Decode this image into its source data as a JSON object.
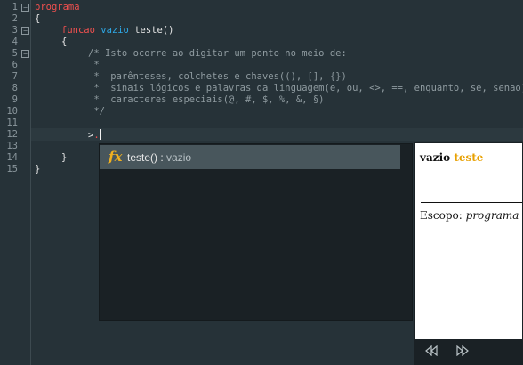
{
  "editor": {
    "line_numbers": [
      "1",
      "2",
      "3",
      "4",
      "5",
      "6",
      "7",
      "8",
      "9",
      "10",
      "11",
      "12",
      "13",
      "14",
      "15"
    ],
    "fold_markers": [
      "−",
      "−",
      "−"
    ],
    "code": {
      "l1": "programa",
      "l2": "{",
      "l3_kw": "funcao",
      "l3_type": "vazio",
      "l3_rest": "teste()",
      "l4": "{",
      "l5": "/* Isto ocorre ao digitar um ponto no meio de:",
      "l6": " *",
      "l7": " *  parênteses, colchetes e chaves((), [], {})",
      "l8": " *  sinais lógicos e palavras da linguagem(e, ou, <>, ==, enquanto, se, senao)",
      "l9": " *  caracteres especiais(@, #, $, %, &, §)",
      "l10": " */",
      "l12_a": ">",
      "l12_b": ".",
      "l14": "}",
      "l15": "}"
    }
  },
  "autocomplete": {
    "icon": "fx-icon",
    "name": "teste()",
    "separator": " : ",
    "return_type": "vazio"
  },
  "doc_panel": {
    "type_word": "vazio",
    "func_name": "teste",
    "scope_label": "Escopo:",
    "scope_value": "programa"
  },
  "colors": {
    "keyword_red": "#f0504f",
    "keyword_blue": "#2ea8e6",
    "accent_yellow": "#f0b020"
  }
}
